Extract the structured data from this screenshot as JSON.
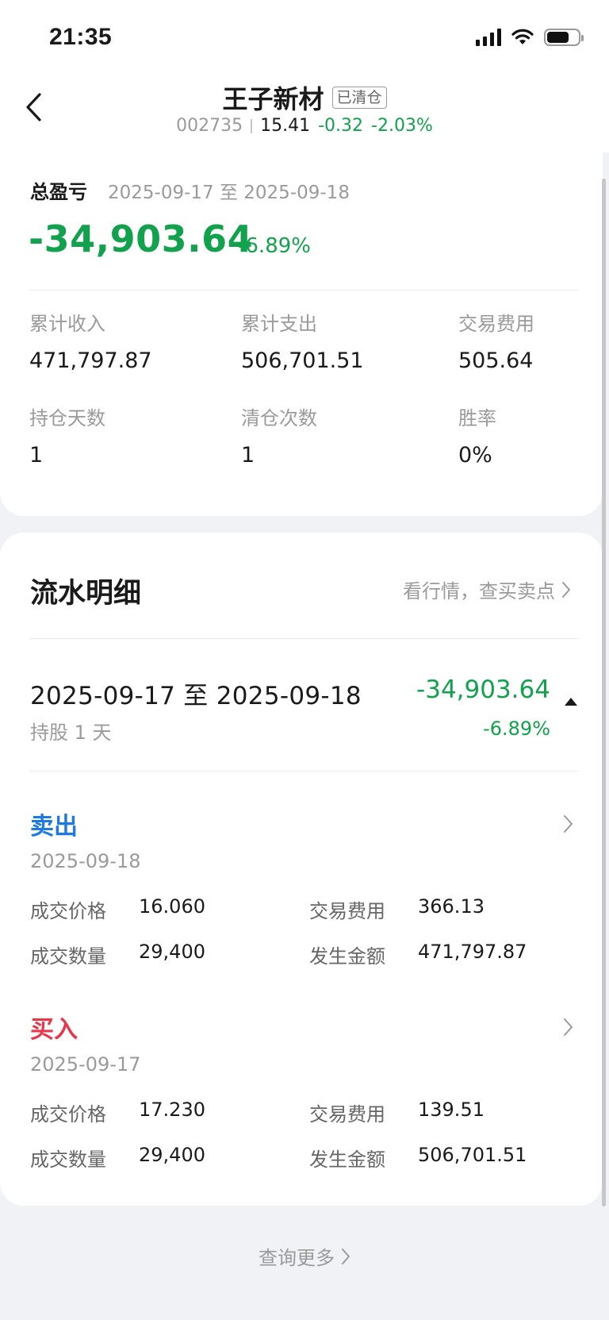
{
  "status_bar": {
    "time": "21:35"
  },
  "header": {
    "title": "王子新材",
    "badge": "已清仓",
    "code": "002735",
    "price": "15.41",
    "change": "-0.32",
    "change_pct": "-2.03%"
  },
  "summary": {
    "label": "总盈亏",
    "range": "2025-09-17 至 2025-09-18",
    "value": "-34,903.64",
    "pct": "-6.89%",
    "stats": [
      {
        "label": "累计收入",
        "value": "471,797.87"
      },
      {
        "label": "累计支出",
        "value": "506,701.51"
      },
      {
        "label": "交易费用",
        "value": "505.64"
      },
      {
        "label": "持仓天数",
        "value": "1"
      },
      {
        "label": "清仓次数",
        "value": "1"
      },
      {
        "label": "胜率",
        "value": "0%"
      }
    ]
  },
  "details": {
    "title": "流水明细",
    "link": "看行情，查买卖点",
    "period": {
      "range": "2025-09-17 至 2025-09-18",
      "days": "持股 1 天",
      "pl": "-34,903.64",
      "pct": "-6.89%"
    },
    "trades": [
      {
        "type": "卖出",
        "date": "2025-09-18",
        "price_label": "成交价格",
        "price": "16.060",
        "fee_label": "交易费用",
        "fee": "366.13",
        "qty_label": "成交数量",
        "qty": "29,400",
        "amount_label": "发生金额",
        "amount": "471,797.87"
      },
      {
        "type": "买入",
        "date": "2025-09-17",
        "price_label": "成交价格",
        "price": "17.230",
        "fee_label": "交易费用",
        "fee": "139.51",
        "qty_label": "成交数量",
        "qty": "29,400",
        "amount_label": "发生金额",
        "amount": "506,701.51"
      }
    ]
  },
  "footer": {
    "more": "查询更多"
  },
  "colors": {
    "loss": "#12a14c",
    "sell": "#1f7ae0",
    "buy": "#e8364a"
  }
}
